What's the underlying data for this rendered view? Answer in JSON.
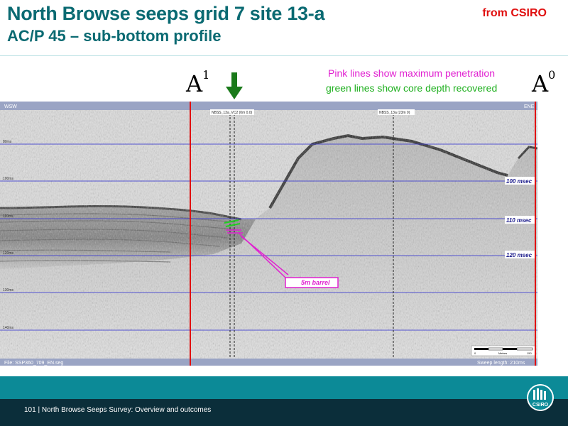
{
  "header": {
    "title": "North Browse seeps grid 7 site 13-a",
    "subtitle": "AC/P 45 – sub-bottom profile",
    "source": "from CSIRO"
  },
  "legend": {
    "pink_note": "Pink lines show maximum penetration",
    "green_note": "green lines show core depth recovered"
  },
  "points": {
    "start": "A",
    "start_sup": "1",
    "end": "A",
    "end_sup": "0"
  },
  "profile": {
    "dir_left": "WSW",
    "dir_right": "ENE",
    "station_left": "NBSS_13a_VC2 (0m 0.0)",
    "station_right": "NBSS_13a (23m 0)",
    "depth_ticks": [
      "80ms",
      "100ms",
      "110ms",
      "120ms",
      "130ms",
      "140ms"
    ],
    "msec_labels": [
      "100 msec",
      "110 msec",
      "120 msec"
    ],
    "barrel_label": "5m barrel",
    "file_label": "File: SSP360_709_EN.seg",
    "sweep_label": "Sweep length: 210ms",
    "scale_start": "0",
    "scale_unit": "Metres",
    "scale_end": "150"
  },
  "footer": {
    "text": "101  |  North Browse Seeps Survey: Overview and outcomes",
    "logo_text": "CSIRO"
  },
  "colors": {
    "title": "#0a6a72",
    "source": "#e01010",
    "pink": "#e020d0",
    "green": "#1fb01f",
    "band": "#0c8a97",
    "dark": "#0b2e3a"
  }
}
